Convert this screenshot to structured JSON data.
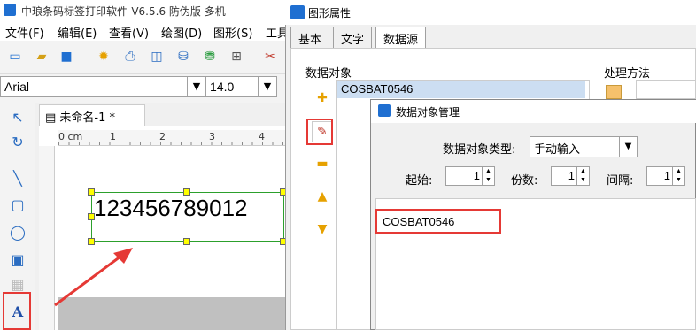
{
  "app": {
    "title": "中琅条码标签打印软件-V6.5.6 防伪版 多机",
    "menu": [
      "文件(F)",
      "编辑(E)",
      "查看(V)",
      "绘图(D)",
      "图形(S)",
      "工具"
    ],
    "font_name": "Arial",
    "font_size": "14.0",
    "doc_tab": "未命名-1 *",
    "ruler_labels": [
      "0 cm",
      "1",
      "2",
      "3",
      "4"
    ],
    "barcode_text": "123456789012"
  },
  "dialog1": {
    "title": "图形属性",
    "tabs": [
      "基本",
      "文字",
      "数据源"
    ],
    "active_tab": "数据源",
    "ds_label": "数据对象",
    "proc_label": "处理方法",
    "selected_item": "COSBAT0546"
  },
  "dialog2": {
    "title": "数据对象管理",
    "type_label": "数据对象类型:",
    "type_value": "手动输入",
    "start_label": "起始:",
    "start_value": "1",
    "copies_label": "份数:",
    "copies_value": "1",
    "interval_label": "间隔:",
    "interval_value": "1",
    "data_value": "COSBAT0546"
  },
  "colors": {
    "highlight": "#e53935",
    "selection": "#ccdef2",
    "brand": "#1f6fd1"
  }
}
